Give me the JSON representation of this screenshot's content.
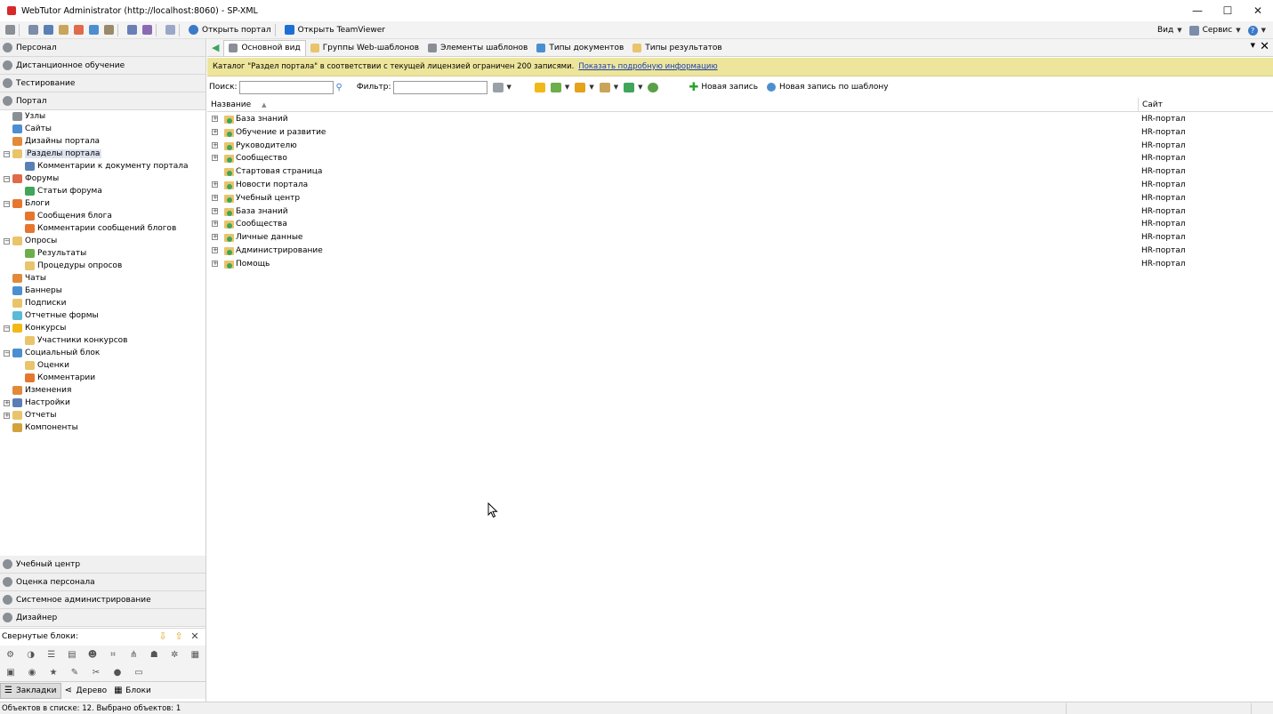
{
  "window": {
    "title": "WebTutor Administrator (http://localhost:8060) - SP-XML",
    "minimize_icon": "—",
    "maximize_icon": "☐",
    "close_icon": "✕"
  },
  "toolbar": {
    "open_portal": "Открыть портал",
    "open_teamviewer": "Открыть TeamViewer",
    "view": "Вид",
    "service": "Сервис",
    "help_icon": "?"
  },
  "left_panel": {
    "sections_top": [
      {
        "label": "Персонал"
      },
      {
        "label": "Дистанционное обучение"
      },
      {
        "label": "Тестирование"
      },
      {
        "label": "Портал"
      }
    ],
    "tree": [
      {
        "label": "Узлы",
        "level": 1,
        "exp": "",
        "icon_color": "#8a8f96"
      },
      {
        "label": "Сайты",
        "level": 1,
        "exp": "",
        "icon_color": "#4c8fd0"
      },
      {
        "label": "Дизайны портала",
        "level": 1,
        "exp": "",
        "icon_color": "#e28a3a"
      },
      {
        "label": "Разделы портала",
        "level": 1,
        "exp": "−",
        "icon_color": "#e9c46a",
        "selected": true
      },
      {
        "label": "Комментарии к документу портала",
        "level": 2,
        "exp": "",
        "icon_color": "#5a7fb5"
      },
      {
        "label": "Форумы",
        "level": 1,
        "exp": "−",
        "icon_color": "#e06a4a"
      },
      {
        "label": "Статьи форума",
        "level": 2,
        "exp": "",
        "icon_color": "#3fa65a"
      },
      {
        "label": "Блоги",
        "level": 1,
        "exp": "−",
        "icon_color": "#e6762e"
      },
      {
        "label": "Сообщения блога",
        "level": 2,
        "exp": "",
        "icon_color": "#e6762e"
      },
      {
        "label": "Комментарии сообщений блогов",
        "level": 2,
        "exp": "",
        "icon_color": "#e6762e"
      },
      {
        "label": "Опросы",
        "level": 1,
        "exp": "−",
        "icon_color": "#e9c46a"
      },
      {
        "label": "Результаты",
        "level": 2,
        "exp": "",
        "icon_color": "#6cae4a"
      },
      {
        "label": "Процедуры опросов",
        "level": 2,
        "exp": "",
        "icon_color": "#e9c46a"
      },
      {
        "label": "Чаты",
        "level": 1,
        "exp": "",
        "icon_color": "#e28a3a"
      },
      {
        "label": "Баннеры",
        "level": 1,
        "exp": "",
        "icon_color": "#4c8fd0"
      },
      {
        "label": "Подписки",
        "level": 1,
        "exp": "",
        "icon_color": "#e9c46a"
      },
      {
        "label": "Отчетные формы",
        "level": 1,
        "exp": "",
        "icon_color": "#5bbad5"
      },
      {
        "label": "Конкурсы",
        "level": 1,
        "exp": "−",
        "icon_color": "#f2b817"
      },
      {
        "label": "Участники конкурсов",
        "level": 2,
        "exp": "",
        "icon_color": "#e9c46a"
      },
      {
        "label": "Социальный блок",
        "level": 1,
        "exp": "−",
        "icon_color": "#4c8fd0"
      },
      {
        "label": "Оценки",
        "level": 2,
        "exp": "",
        "icon_color": "#e9c46a"
      },
      {
        "label": "Комментарии",
        "level": 2,
        "exp": "",
        "icon_color": "#e6762e"
      },
      {
        "label": "Изменения",
        "level": 1,
        "exp": "",
        "icon_color": "#e28a3a"
      },
      {
        "label": "Настройки",
        "level": 1,
        "exp": "+",
        "icon_color": "#5a7fb5"
      },
      {
        "label": "Отчеты",
        "level": 1,
        "exp": "+",
        "icon_color": "#e9c46a"
      },
      {
        "label": "Компоненты",
        "level": 1,
        "exp": "",
        "icon_color": "#d4a23a"
      }
    ],
    "sections_bottom": [
      {
        "label": "Учебный центр"
      },
      {
        "label": "Оценка персонала"
      },
      {
        "label": "Системное администрирование"
      },
      {
        "label": "Дизайнер"
      }
    ],
    "collapsed_blocks_label": "Свернутые блоки:",
    "collapsed_controls": {
      "down": "⇩",
      "up": "⇧",
      "close": "✕"
    },
    "view_tabs": [
      {
        "label": "Закладки",
        "icon": "☰"
      },
      {
        "label": "Дерево",
        "icon": "⋖"
      },
      {
        "label": "Блоки",
        "icon": "▦"
      }
    ]
  },
  "doc_tabs": [
    {
      "label": "Основной вид",
      "icon_color": "#8a8f96",
      "active": true
    },
    {
      "label": "Группы Web-шаблонов",
      "icon_color": "#e9c46a",
      "active": false
    },
    {
      "label": "Элементы шаблонов",
      "icon_color": "#8a8f96",
      "active": false
    },
    {
      "label": "Типы документов",
      "icon_color": "#4c8fd0",
      "active": false
    },
    {
      "label": "Типы результатов",
      "icon_color": "#e9c46a",
      "active": false
    }
  ],
  "notice": {
    "text": "Каталог \"Раздел портала\" в соответствии с текущей лицензией ограничен 200 записями.",
    "link": "Показать подробную информацию"
  },
  "search": {
    "search_label": "Поиск:",
    "search_value": "",
    "filter_label": "Фильтр:",
    "filter_value": "",
    "new_record": "Новая запись",
    "new_record_by_template": "Новая запись по шаблону"
  },
  "grid": {
    "columns": [
      "Название",
      "Сайт"
    ],
    "rows": [
      {
        "name": "База знаний",
        "site": "HR-портал",
        "expandable": true
      },
      {
        "name": "Обучение и развитие",
        "site": "HR-портал",
        "expandable": true
      },
      {
        "name": "Руководителю",
        "site": "HR-портал",
        "expandable": true
      },
      {
        "name": "Сообщество",
        "site": "HR-портал",
        "expandable": true
      },
      {
        "name": "Стартовая страница",
        "site": "HR-портал",
        "expandable": false
      },
      {
        "name": "Новости портала",
        "site": "HR-портал",
        "expandable": true
      },
      {
        "name": "Учебный центр",
        "site": "HR-портал",
        "expandable": true
      },
      {
        "name": "База знаний",
        "site": "HR-портал",
        "expandable": true
      },
      {
        "name": "Сообщества",
        "site": "HR-портал",
        "expandable": true
      },
      {
        "name": "Личные данные",
        "site": "HR-портал",
        "expandable": true
      },
      {
        "name": "Администрирование",
        "site": "HR-портал",
        "expandable": true
      },
      {
        "name": "Помощь",
        "site": "HR-портал",
        "expandable": true
      }
    ]
  },
  "status": {
    "text": "Объектов в списке: 12. Выбрано объектов: 1"
  }
}
